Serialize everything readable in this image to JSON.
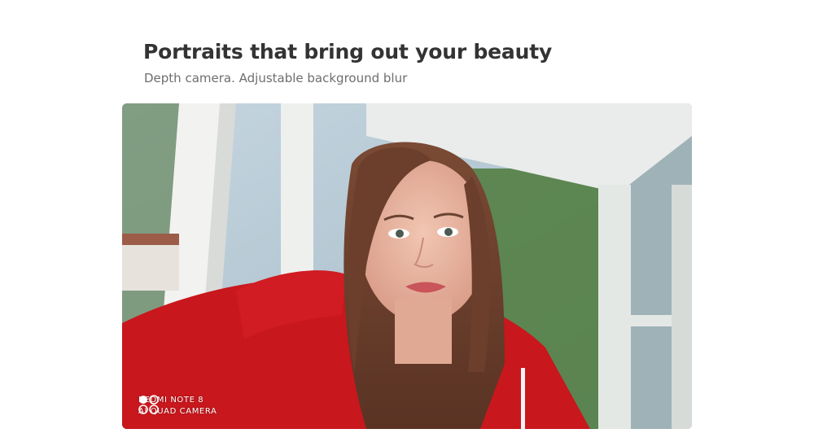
{
  "header": {
    "title": "Portraits that bring out your beauty",
    "subtitle": "Depth camera. Adjustable background blur"
  },
  "photo": {
    "watermark": {
      "line1": "REDMI NOTE 8",
      "line2": "AI QUAD CAMERA",
      "icon": "quad-camera-icon"
    }
  }
}
